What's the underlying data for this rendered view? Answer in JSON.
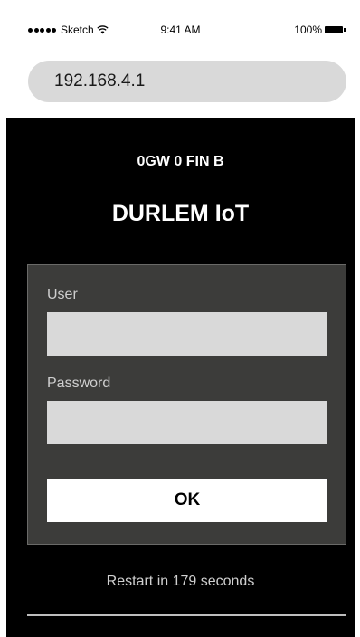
{
  "status_bar": {
    "carrier": "Sketch",
    "time": "9:41 AM",
    "battery": "100%",
    "icons": [
      "signal-dots-icon",
      "wifi-icon",
      "battery-icon"
    ]
  },
  "address_bar": {
    "url": "192.168.4.1"
  },
  "header": {
    "device_id": "0GW 0 FIN B",
    "title": "DURLEM IoT"
  },
  "login_form": {
    "user_label": "User",
    "user_value": "",
    "password_label": "Password",
    "password_value": "",
    "ok_label": "OK"
  },
  "footer": {
    "restart_text": "Restart in 179 seconds"
  },
  "colors": {
    "background": "#000000",
    "card": "#3c3c3a",
    "input": "#d9d9d9",
    "button": "#ffffff"
  }
}
